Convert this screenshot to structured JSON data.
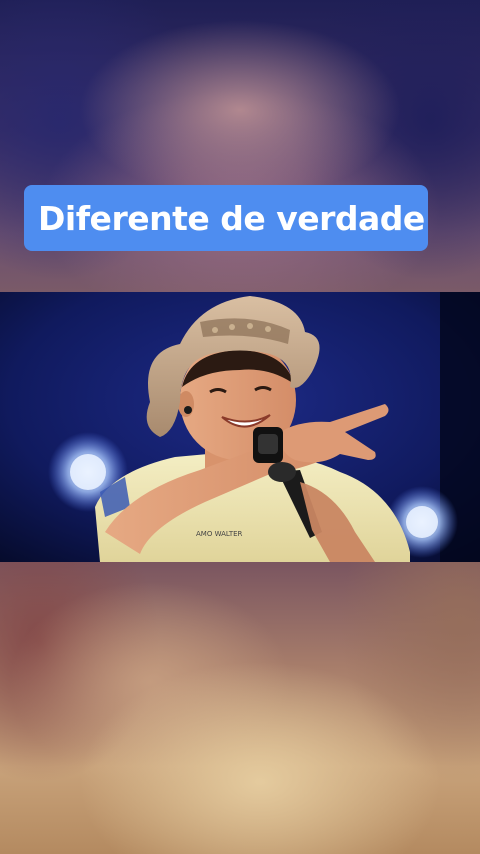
{
  "caption": {
    "text": "Diferente de verdade",
    "background_color": "#4e8df0",
    "text_color": "#ffffff"
  },
  "photo": {
    "subject": "singer in cowboy hat pointing, holding microphone on stage",
    "shirt_text": "AMO WALTER"
  }
}
